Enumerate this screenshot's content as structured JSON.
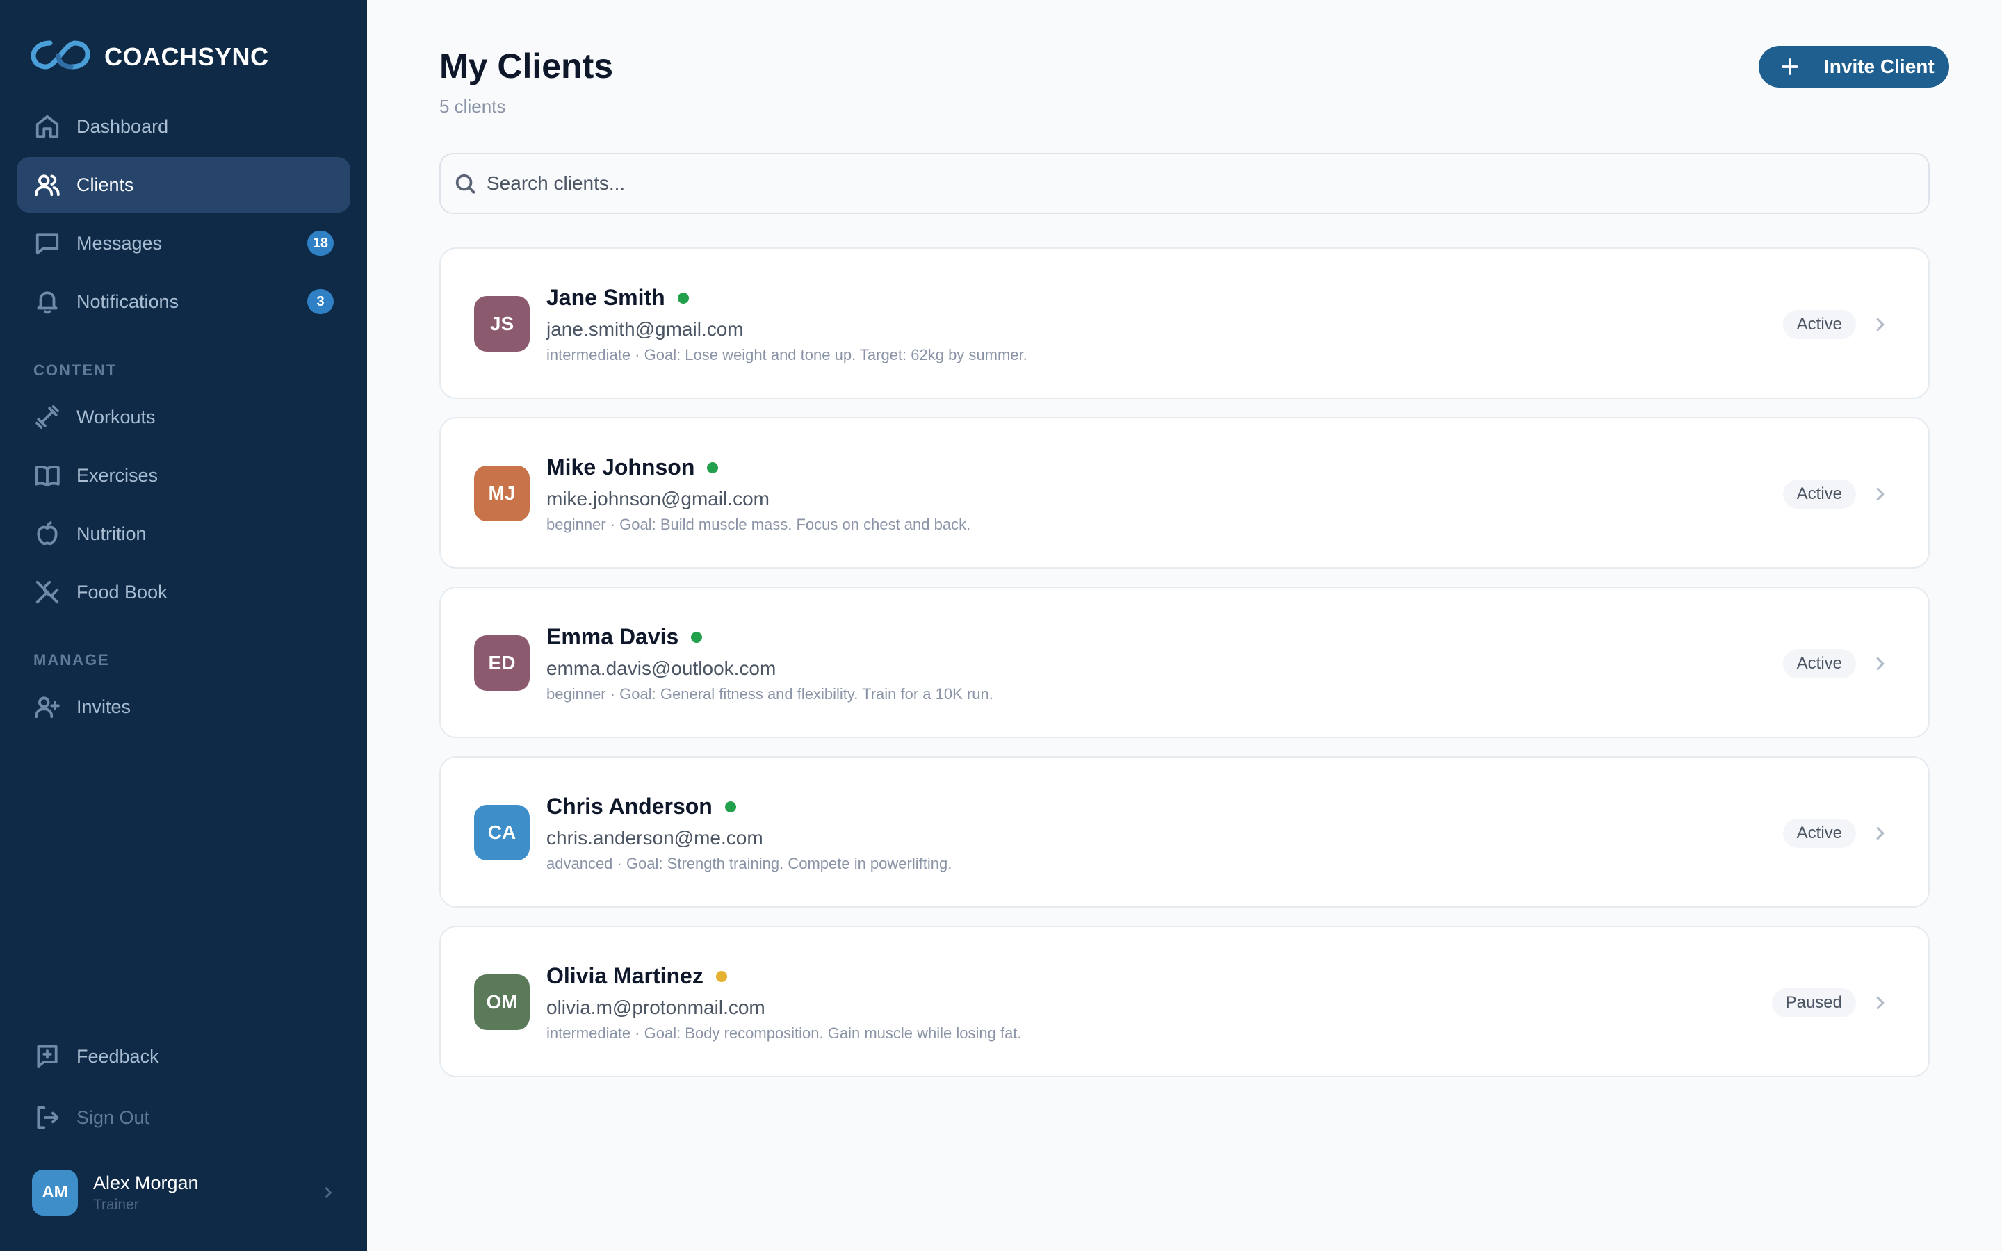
{
  "brand": {
    "name": "COACHSYNC"
  },
  "sidebar": {
    "items": [
      {
        "label": "Dashboard",
        "icon": "home-icon"
      },
      {
        "label": "Clients",
        "icon": "users-icon",
        "active": true
      },
      {
        "label": "Messages",
        "icon": "message-icon",
        "badge": "18"
      },
      {
        "label": "Notifications",
        "icon": "bell-icon",
        "badge": "3"
      }
    ],
    "content_label": "CONTENT",
    "content_items": [
      {
        "label": "Workouts",
        "icon": "dumbbell-icon"
      },
      {
        "label": "Exercises",
        "icon": "book-icon"
      },
      {
        "label": "Nutrition",
        "icon": "apple-icon"
      },
      {
        "label": "Food Book",
        "icon": "utensils-icon"
      }
    ],
    "manage_label": "MANAGE",
    "manage_items": [
      {
        "label": "Invites",
        "icon": "user-plus-icon"
      }
    ],
    "footer_items": [
      {
        "label": "Feedback",
        "icon": "feedback-icon"
      },
      {
        "label": "Sign Out",
        "icon": "sign-out-icon"
      }
    ],
    "user": {
      "initials": "AM",
      "name": "Alex Morgan",
      "role": "Trainer"
    }
  },
  "header": {
    "title": "My Clients",
    "subtitle": "5 clients",
    "invite_label": "Invite Client"
  },
  "search": {
    "placeholder": "Search clients..."
  },
  "clients": [
    {
      "initials": "JS",
      "name": "Jane Smith",
      "email": "jane.smith@gmail.com",
      "meta": "intermediate · Goal: Lose weight and tone up. Target: 62kg by summer.",
      "status": "Active",
      "avatar_color": "#8c5a6e",
      "dot_color": "#22a04b"
    },
    {
      "initials": "MJ",
      "name": "Mike Johnson",
      "email": "mike.johnson@gmail.com",
      "meta": "beginner · Goal: Build muscle mass. Focus on chest and back.",
      "status": "Active",
      "avatar_color": "#c8734a",
      "dot_color": "#22a04b"
    },
    {
      "initials": "ED",
      "name": "Emma Davis",
      "email": "emma.davis@outlook.com",
      "meta": "beginner · Goal: General fitness and flexibility. Train for a 10K run.",
      "status": "Active",
      "avatar_color": "#8c5a6e",
      "dot_color": "#22a04b"
    },
    {
      "initials": "CA",
      "name": "Chris Anderson",
      "email": "chris.anderson@me.com",
      "meta": "advanced · Goal: Strength training. Compete in powerlifting.",
      "status": "Active",
      "avatar_color": "#3e8fc9",
      "dot_color": "#22a04b"
    },
    {
      "initials": "OM",
      "name": "Olivia Martinez",
      "email": "olivia.m@protonmail.com",
      "meta": "intermediate · Goal: Body recomposition. Gain muscle while losing fat.",
      "status": "Paused",
      "avatar_color": "#5a7a5a",
      "dot_color": "#e6b030"
    }
  ]
}
